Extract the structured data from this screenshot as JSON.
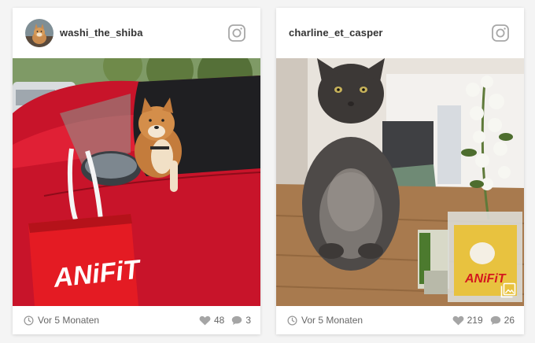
{
  "posts": [
    {
      "username": "washi_the_shiba",
      "time": "Vor 5 Monaten",
      "likes": "48",
      "comments": "3",
      "photo_text": "ANiFiT"
    },
    {
      "username": "charline_et_casper",
      "time": "Vor 5 Monaten",
      "likes": "219",
      "comments": "26",
      "photo_text": "ANiFiT",
      "is_gallery": true
    }
  ],
  "icons": {
    "platform": "instagram-icon",
    "time": "clock-icon",
    "likes": "heart-icon",
    "comments": "comment-icon",
    "gallery": "gallery-icon"
  }
}
